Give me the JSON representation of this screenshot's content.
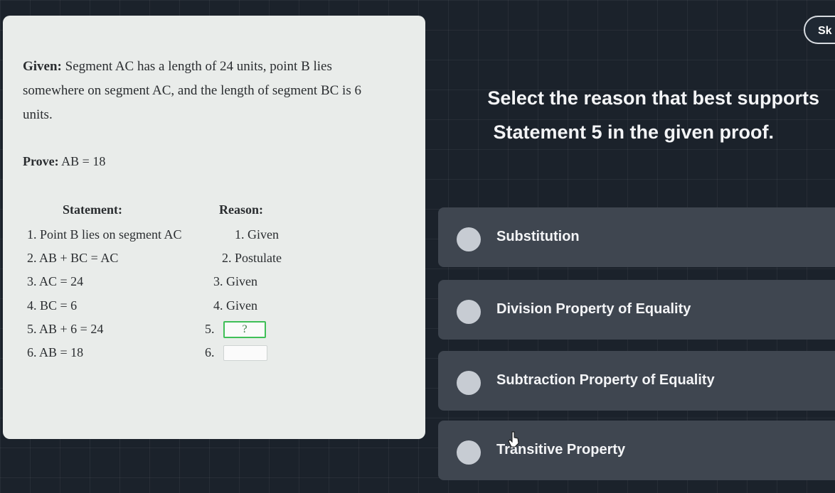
{
  "proof": {
    "given_label": "Given:",
    "given_text": "Segment AC has a length of 24 units, point B lies somewhere on segment AC, and the length of segment BC is 6 units.",
    "prove_label": "Prove:",
    "prove_text": "AB = 18",
    "statement_header": "Statement:",
    "reason_header": "Reason:",
    "rows": [
      {
        "statement": "1. Point B lies on segment AC",
        "reason": "1. Given"
      },
      {
        "statement": "2. AB + BC = AC",
        "reason": "2. Postulate"
      },
      {
        "statement": "3. AC = 24",
        "reason": "3. Given"
      },
      {
        "statement": "4. BC = 6",
        "reason": "4. Given"
      },
      {
        "statement": "5. AB + 6 = 24",
        "reason": "5.",
        "box": "?"
      },
      {
        "statement": "6. AB = 18",
        "reason": "6."
      }
    ]
  },
  "question": {
    "line1": "Select the reason that best supports",
    "line2": "Statement 5 in the given proof."
  },
  "options": [
    {
      "label": "Substitution"
    },
    {
      "label": "Division Property of Equality"
    },
    {
      "label": "Subtraction Property of Equality"
    },
    {
      "label": "Transitive Property"
    }
  ],
  "skip_label": "Sk"
}
